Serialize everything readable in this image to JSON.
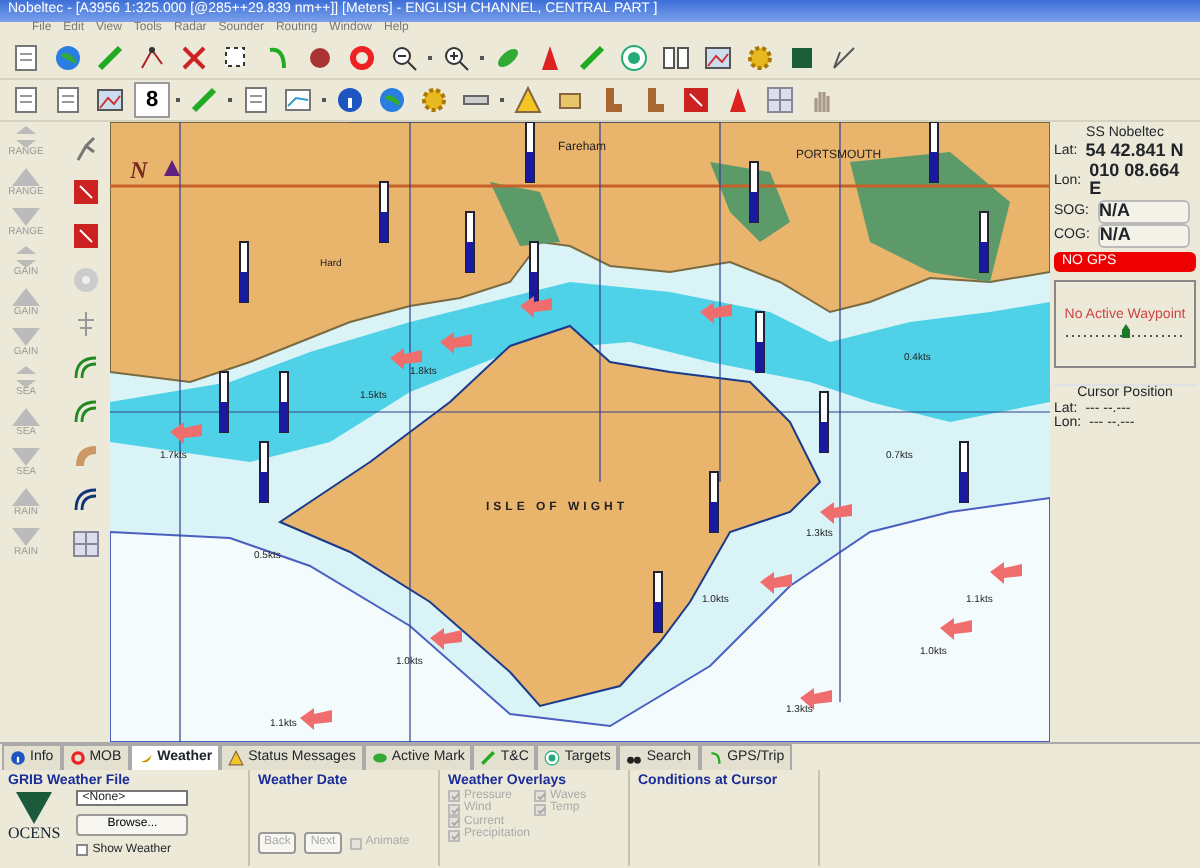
{
  "window": {
    "title": "Nobeltec - [A3956 1:325.000 [@285++29.839 nm++]] [Meters] - ENGLISH CHANNEL, CENTRAL PART ]"
  },
  "menu": [
    "File",
    "Edit",
    "View",
    "Tools",
    "Radar",
    "Sounder",
    "Routing",
    "Window",
    "Help"
  ],
  "toolbar": {
    "text_button": "8"
  },
  "radar_controls": [
    {
      "kind": "auto",
      "label": "RANGE"
    },
    {
      "kind": "up",
      "label": "RANGE"
    },
    {
      "kind": "down",
      "label": "RANGE"
    },
    {
      "kind": "auto",
      "label": "GAIN"
    },
    {
      "kind": "up",
      "label": "GAIN"
    },
    {
      "kind": "down",
      "label": "GAIN"
    },
    {
      "kind": "auto",
      "label": "SEA"
    },
    {
      "kind": "up",
      "label": "SEA"
    },
    {
      "kind": "down",
      "label": "SEA"
    },
    {
      "kind": "up",
      "label": "RAIN"
    },
    {
      "kind": "down",
      "label": "RAIN"
    }
  ],
  "chart": {
    "north_label": "N",
    "places": [
      "Fareham",
      "PORTSMOUTH",
      "Hard",
      "ISLE OF WIGHT"
    ],
    "current_labels": [
      "1.8kts",
      "1.5kts",
      "1.7kts",
      "0.5kts",
      "1.0kts",
      "1.1kts",
      "1.0kts",
      "1.3kts",
      "1.0kts",
      "1.3kts",
      "0.4kts",
      "0.7kts",
      "1.1kts"
    ]
  },
  "vessel_panel": {
    "name": "SS Nobeltec",
    "lat_label": "Lat:",
    "lat": "54 42.841 N",
    "lon_label": "Lon:",
    "lon": "010 08.664 E",
    "sog_label": "SOG:",
    "sog": "N/A",
    "cog_label": "COG:",
    "cog": "N/A",
    "gps_status": "NO GPS",
    "waypoint": "No Active Waypoint"
  },
  "cursor_panel": {
    "title": "Cursor Position",
    "lat_label": "Lat:",
    "lat": "--- --.---",
    "lon_label": "Lon:",
    "lon": "--- --.---"
  },
  "tabs": [
    {
      "label": "Info",
      "selected": false
    },
    {
      "label": "MOB",
      "selected": false
    },
    {
      "label": "Weather",
      "selected": true
    },
    {
      "label": "Status Messages",
      "selected": false
    },
    {
      "label": "Active Mark",
      "selected": false
    },
    {
      "label": "T&C",
      "selected": false
    },
    {
      "label": "Targets",
      "selected": false
    },
    {
      "label": "Search",
      "selected": false
    },
    {
      "label": "GPS/Trip",
      "selected": false
    }
  ],
  "weather": {
    "grib_title": "GRIB Weather File",
    "logo": "OCENS",
    "file_value": "<None>",
    "browse": "Browse...",
    "show_weather": {
      "label": "Show Weather",
      "checked": false
    },
    "date_title": "Weather Date",
    "back": "Back",
    "next": "Next",
    "animate": {
      "label": "Animate",
      "checked": false,
      "disabled": true
    },
    "overlays_title": "Weather Overlays",
    "overlays": [
      {
        "label": "Pressure",
        "checked": true,
        "disabled": true
      },
      {
        "label": "Wind",
        "checked": true,
        "disabled": true
      },
      {
        "label": "Current",
        "checked": true,
        "disabled": true
      },
      {
        "label": "Precipitation",
        "checked": true,
        "disabled": true
      },
      {
        "label": "Waves",
        "checked": true,
        "disabled": true
      },
      {
        "label": "Temp",
        "checked": true,
        "disabled": true
      }
    ],
    "conditions_title": "Conditions at Cursor"
  }
}
